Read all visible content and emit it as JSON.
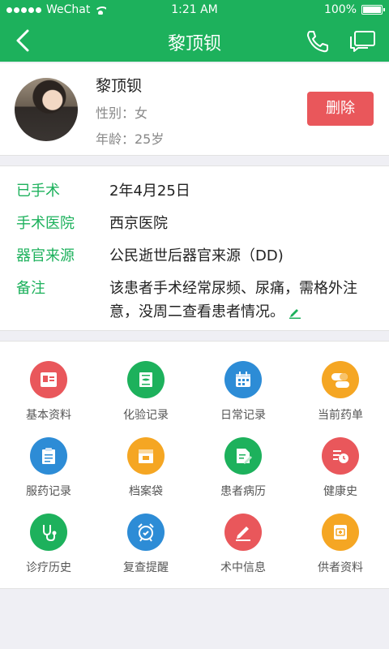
{
  "status_bar": {
    "carrier": "WeChat",
    "time": "1:21 AM",
    "battery": "100%"
  },
  "header": {
    "title": "黎顶钡"
  },
  "profile": {
    "name": "黎顶钡",
    "sex": "性别：女",
    "age": "年龄：25岁",
    "delete_label": "删除"
  },
  "info": {
    "surgery_label": "已手术",
    "surgery_value": "2年4月25日",
    "hospital_label": "手术医院",
    "hospital_value": "西京医院",
    "source_label": "器官来源",
    "source_value": "公民逝世后器官来源（DD)",
    "note_label": "备注",
    "note_value": "该患者手术经常尿频、尿痛，需格外注意，没周二查看患者情况。"
  },
  "menu": [
    {
      "label": "基本资料",
      "color": "#e9575b",
      "icon": "profile-card-icon"
    },
    {
      "label": "化验记录",
      "color": "#1db15c",
      "icon": "lab-record-icon"
    },
    {
      "label": "日常记录",
      "color": "#2d8cd6",
      "icon": "calendar-icon"
    },
    {
      "label": "当前药单",
      "color": "#f5a623",
      "icon": "pill-icon"
    },
    {
      "label": "服药记录",
      "color": "#2d8cd6",
      "icon": "medication-record-icon"
    },
    {
      "label": "档案袋",
      "color": "#f5a623",
      "icon": "archive-bag-icon"
    },
    {
      "label": "患者病历",
      "color": "#1db15c",
      "icon": "medical-history-icon"
    },
    {
      "label": "健康史",
      "color": "#e9575b",
      "icon": "health-history-icon"
    },
    {
      "label": "诊疗历史",
      "color": "#1db15c",
      "icon": "stethoscope-icon"
    },
    {
      "label": "复查提醒",
      "color": "#2d8cd6",
      "icon": "alarm-clock-icon"
    },
    {
      "label": "术中信息",
      "color": "#e9575b",
      "icon": "pen-icon"
    },
    {
      "label": "供者资料",
      "color": "#f5a623",
      "icon": "donor-folder-icon"
    }
  ],
  "colors": {
    "brand": "#1db15c",
    "danger": "#e9575b"
  }
}
